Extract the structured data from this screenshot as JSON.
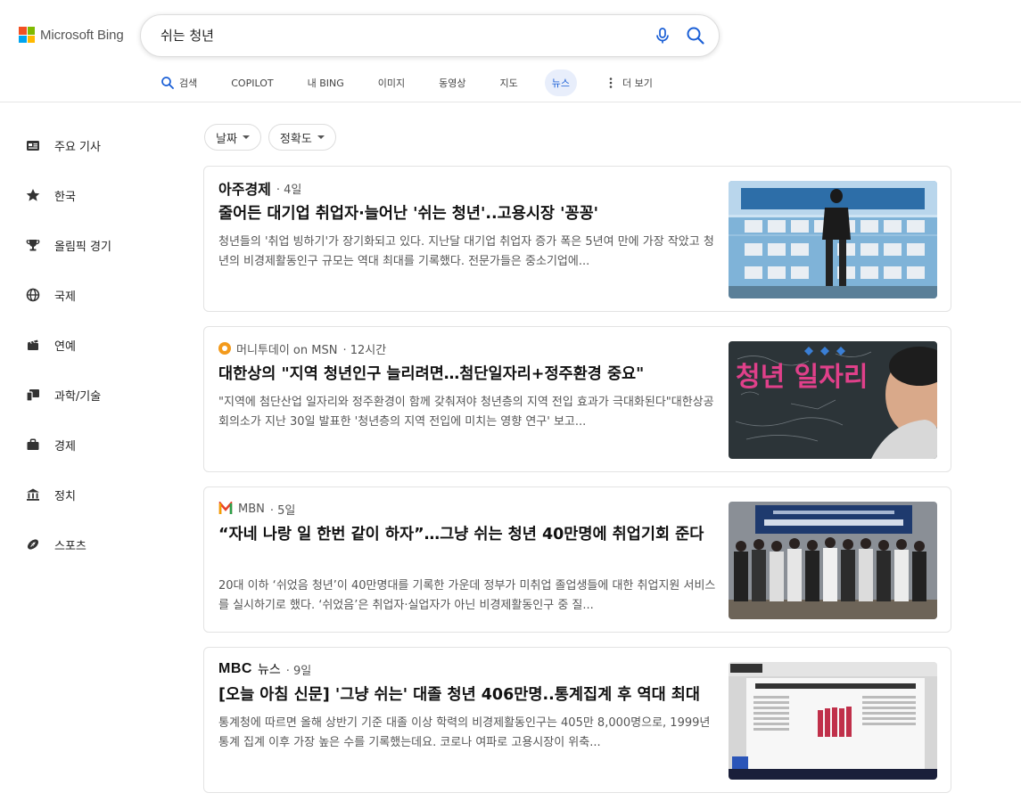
{
  "brand": {
    "name": "Microsoft Bing"
  },
  "search": {
    "query": "쉬는 청년"
  },
  "tabs": [
    {
      "label": "검색",
      "icon": "search-icon"
    },
    {
      "label": "COPILOT"
    },
    {
      "label": "내 BING"
    },
    {
      "label": "이미지"
    },
    {
      "label": "동영상"
    },
    {
      "label": "지도"
    },
    {
      "label": "뉴스",
      "active": true
    },
    {
      "label": "더 보기",
      "icon": "more-vertical-icon"
    }
  ],
  "sidebar": {
    "items": [
      {
        "label": "주요 기사",
        "icon": "newspaper-icon"
      },
      {
        "label": "한국",
        "icon": "star-icon"
      },
      {
        "label": "올림픽 경기",
        "icon": "trophy-icon"
      },
      {
        "label": "국제",
        "icon": "globe-icon"
      },
      {
        "label": "연예",
        "icon": "clapperboard-icon"
      },
      {
        "label": "과학/기술",
        "icon": "devices-icon"
      },
      {
        "label": "경제",
        "icon": "briefcase-icon"
      },
      {
        "label": "정치",
        "icon": "government-icon"
      },
      {
        "label": "스포츠",
        "icon": "football-icon"
      }
    ]
  },
  "filters": [
    {
      "label": "날짜"
    },
    {
      "label": "정확도"
    }
  ],
  "articles": [
    {
      "source": "아주경제",
      "age": "· 4일",
      "title": "줄어든 대기업 취업자·늘어난 '쉬는 청년'..고용시장 '꽁꽁'",
      "snippet": "청년들의 '취업 빙하기'가 장기화되고 있다. 지난달 대기업 취업자 증가 폭은 5년여 만에 가장 작았고 청년의 비경제활동인구 규모는 역대 최대를 기록했다. 전문가들은 중소기업에...",
      "image": "job-fair-board-photo"
    },
    {
      "source": "머니투데이 on MSN",
      "age": "· 12시간",
      "title": "대한상의 \"지역 청년인구 늘리려면…첨단일자리+정주환경 중요\"",
      "snippet": "\"지역에 첨단산업 일자리와 정주환경이 함께 갖춰져야 청년층의 지역 전입 효과가 극대화된다\"대한상공회의소가 지난 30일 발표한 '청년층의 지역 전입에 미치는 영향 연구' 보고...",
      "image": "youth-jobs-chalkboard-photo",
      "image_text": "청년 일자리"
    },
    {
      "source": "MBN",
      "age": "· 5일",
      "title": "“자네 나랑 일 한번 같이 하자”…그냥 쉬는 청년 40만명에 취업기회 준다",
      "snippet": "20대 이하 ‘쉬었음 청년’이 40만명대를 기록한 가운데 정부가 미취업 졸업생들에 대한 취업지원 서비스를 실시하기로 했다. ‘쉬었음’은 취업자·실업자가 아닌 비경제활동인구 중 질...",
      "image": "group-photo-banner"
    },
    {
      "source": "뉴스",
      "source_logo": "MBC",
      "age": "· 9일",
      "title": "[오늘 아침 신문] '그냥 쉬는' 대졸 청년 406만명..통계집계 후 역대 최대",
      "snippet": "통계청에 따르면 올해 상반기 기준 대졸 이상 학력의 비경제활동인구는 405만 8,000명으로, 1999년 통계 집계 이후 가장 높은 수를 기록했는데요. 코로나 여파로 고용시장이 위축...",
      "image": "newspaper-broadcast-screenshot"
    }
  ],
  "colors": {
    "accent": "#1a5fd6",
    "tab_active_bg": "#e8eefb",
    "logo_red": "#f25022",
    "logo_green": "#7fba00",
    "logo_blue": "#00a4ef",
    "logo_yellow": "#ffb900"
  }
}
